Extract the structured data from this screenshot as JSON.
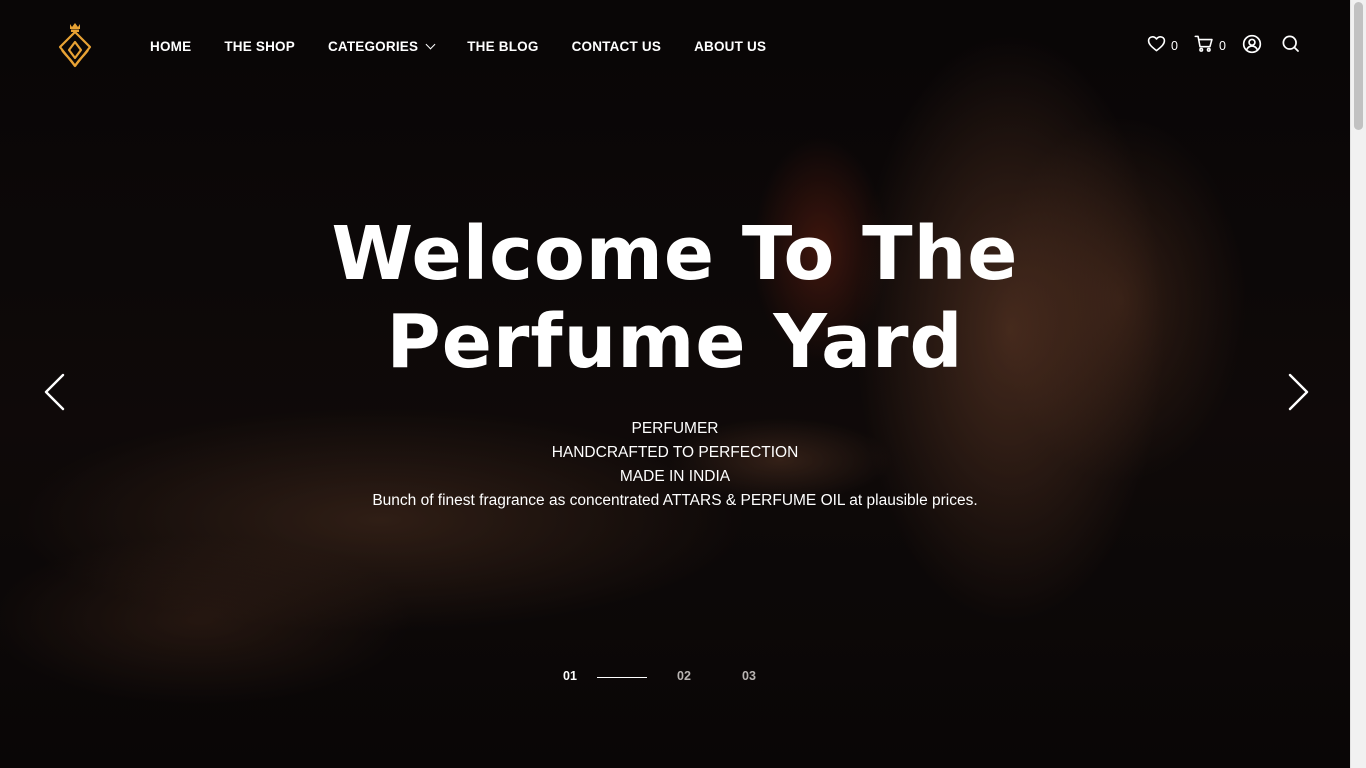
{
  "brand": {
    "logo_icon": "perfume-bottle-logo-icon",
    "accent_color": "#e8a234"
  },
  "nav": {
    "items": [
      {
        "label": "HOME"
      },
      {
        "label": "THE SHOP"
      },
      {
        "label": "CATEGORIES",
        "has_dropdown": true
      },
      {
        "label": "THE BLOG"
      },
      {
        "label": "CONTACT US"
      },
      {
        "label": "ABOUT US"
      }
    ]
  },
  "header_icons": {
    "wishlist": {
      "icon": "heart-icon",
      "count": "0"
    },
    "cart": {
      "icon": "cart-icon",
      "count": "0"
    },
    "account": {
      "icon": "user-circle-icon"
    },
    "search": {
      "icon": "search-icon"
    }
  },
  "hero": {
    "title_line1": "Welcome To The",
    "title_line2": "Perfume Yard",
    "lines": [
      "PERFUMER",
      "HANDCRAFTED TO PERFECTION",
      "MADE IN INDIA",
      "Bunch of finest fragrance as concentrated ATTARS & PERFUME OIL at plausible prices."
    ],
    "prev_icon": "chevron-left-icon",
    "next_icon": "chevron-right-icon"
  },
  "slider": {
    "pages": [
      "01",
      "02",
      "03"
    ],
    "active_index": 0
  }
}
